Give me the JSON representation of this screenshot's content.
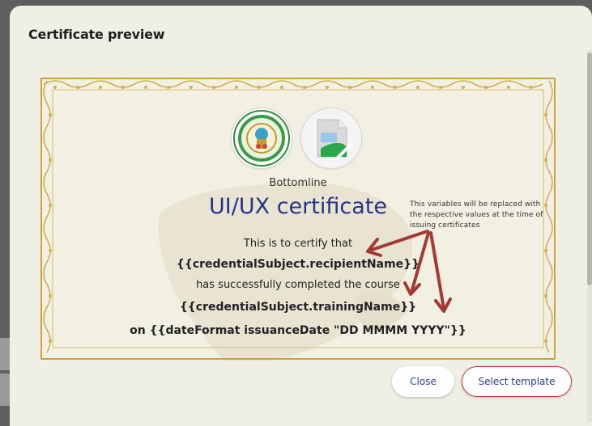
{
  "modal": {
    "title": "Certificate preview"
  },
  "certificate": {
    "issuer_name": "Bottomline",
    "title": "UI/UX certificate",
    "line_certify": "This is to certify that",
    "recipient_variable": "{{credentialSubject.recipientName}}",
    "line_completed": "has successfully completed the course",
    "training_variable": "{{credentialSubject.trainingName}}",
    "date_line": "on {{dateFormat issuanceDate \"DD MMMM  YYYY\"}}",
    "seal_logo_icon": "government-seal-icon",
    "second_logo_icon": "broken-image-icon"
  },
  "annotation": {
    "note": "This variables will be replaced with the respective values at the time of issuing certificates",
    "arrow_color": "#a33a36"
  },
  "footer": {
    "close_label": "Close",
    "select_label": "Select template"
  },
  "colors": {
    "title_blue": "#27338c",
    "accent_red": "#c8383f",
    "border_gold": "#c9a23c"
  }
}
